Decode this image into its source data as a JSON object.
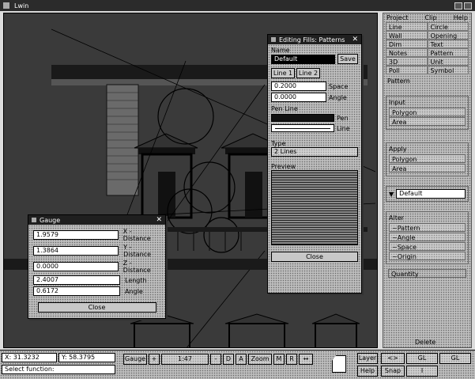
{
  "app": {
    "title": "Lwin"
  },
  "pattern_dialog": {
    "title": "Editing Fills: Patterns",
    "name_label": "Name",
    "name_value": "Default",
    "save_label": "Save",
    "tabs": [
      "Line 1",
      "Line 2"
    ],
    "space_value": "0.2000",
    "space_label": "Space",
    "angle_value": "0.0000",
    "angle_label": "Angle",
    "pen_line_label": "Pen Line",
    "pen_label": "Pen",
    "line_label": "Line",
    "type_label": "Type",
    "type_value": "2 Lines",
    "preview_label": "Preview",
    "close_label": "Close"
  },
  "gauge_dialog": {
    "title": "Gauge",
    "rows": [
      {
        "value": "1.9579",
        "label": "X - Distance"
      },
      {
        "value": "1.3864",
        "label": "Y - Distance"
      },
      {
        "value": "0.0000",
        "label": "Z - Distance"
      },
      {
        "value": "2.4007",
        "label": "Length"
      },
      {
        "value": "0.6172",
        "label": "Angle"
      }
    ],
    "close_label": "Close"
  },
  "right_panel": {
    "menu": [
      "Project",
      "Clip",
      "Help"
    ],
    "tools": [
      "Line",
      "Circle",
      "Wall",
      "Opening",
      "Dim",
      "Text",
      "Notes",
      "Pattern",
      "3D",
      "Unit",
      "Poll",
      "Symbol"
    ],
    "pattern_header": "Pattern",
    "input_header": "Input",
    "input_items": [
      "Polygon",
      "Area"
    ],
    "apply_header": "Apply",
    "apply_items": [
      "Polygon",
      "Area"
    ],
    "pattern_select": "Default",
    "alter_header": "Alter",
    "alter_items": [
      "~Pattern",
      "~Angle",
      "~Space",
      "~Origin"
    ],
    "quantity_label": "Quantity",
    "delete_label": "Delete"
  },
  "statusbar": {
    "x_readout": "X: 31.3232",
    "y_readout": "Y: 58.3795",
    "prompt": "Select function:",
    "gauge_label": "Gauge",
    "plus_label": "+",
    "zoom_value": "1:47",
    "minus_label": "-",
    "d_label": "D",
    "a_label": "A",
    "zoom_label": "Zoom",
    "m_label": "M",
    "r_label": "R",
    "arrows_label": "↔",
    "layer_label": "Layer",
    "help_label": "Help",
    "snap_label": "Snap",
    "i_label": "I",
    "gl_label": "GL",
    "gl2_label": "GL",
    "deg_label": "<>"
  }
}
